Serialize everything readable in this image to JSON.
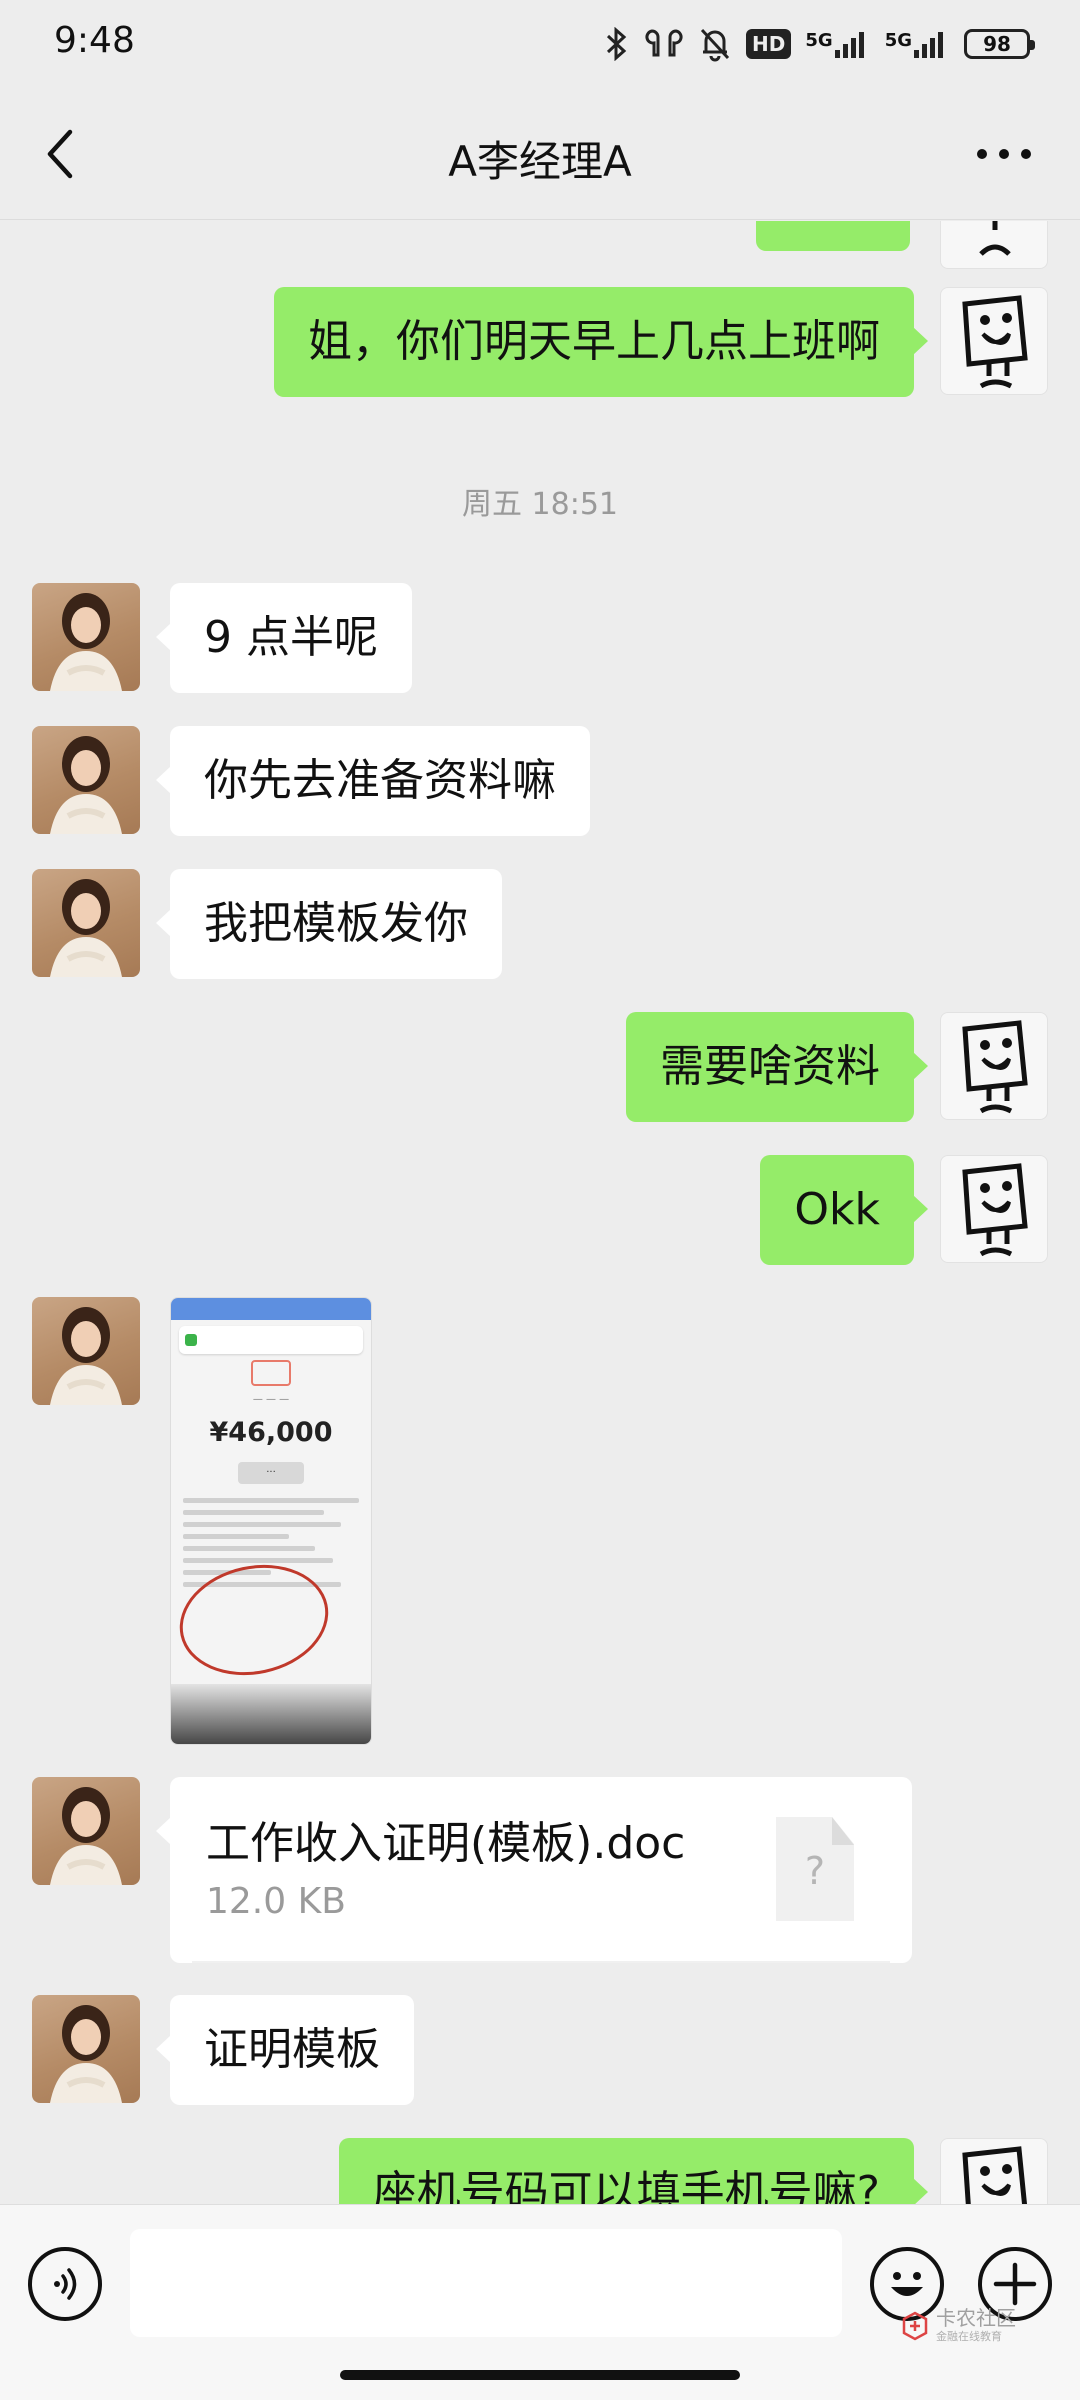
{
  "status_bar": {
    "time": "9:48",
    "icons": [
      "bluetooth-icon",
      "earbuds-icon",
      "mute-bell-icon",
      "hd-icon",
      "5g-signal-icon",
      "5g-signal-icon"
    ],
    "hd_label": "HD",
    "network_label_1": "5G",
    "network_label_2": "5G",
    "battery_level": "98"
  },
  "header": {
    "title": "A李经理A",
    "back_icon": "chevron-left-icon",
    "more_icon": "more-dots-icon"
  },
  "chat": {
    "timestamp": "周五 18:51",
    "messages": [
      {
        "from": "me",
        "text": "姐，你们明天早上几点上班啊"
      },
      {
        "from": "her",
        "text": "9 点半呢"
      },
      {
        "from": "her",
        "text": "你先去准备资料嘛"
      },
      {
        "from": "her",
        "text": "我把模板发你"
      },
      {
        "from": "me",
        "text": "需要啥资料"
      },
      {
        "from": "me",
        "text": "Okk"
      },
      {
        "from": "me",
        "text": "座机号码可以填手机号嘛?"
      }
    ],
    "image": {
      "amount": "¥46,000"
    },
    "file": {
      "name": "工作收入证明(模板).doc",
      "size": "12.0 KB",
      "icon_symbol": "?"
    },
    "last_her_text": "证明模板"
  },
  "input_bar": {
    "placeholder": "",
    "voice_icon": "voice-icon",
    "emoji_icon": "emoji-icon",
    "plus_icon": "plus-icon"
  },
  "watermark": {
    "title": "卡农社区",
    "subtitle": "金融在线教育"
  },
  "colors": {
    "background": "#ededed",
    "outgoing_bubble": "#95ec69",
    "incoming_bubble": "#ffffff"
  }
}
